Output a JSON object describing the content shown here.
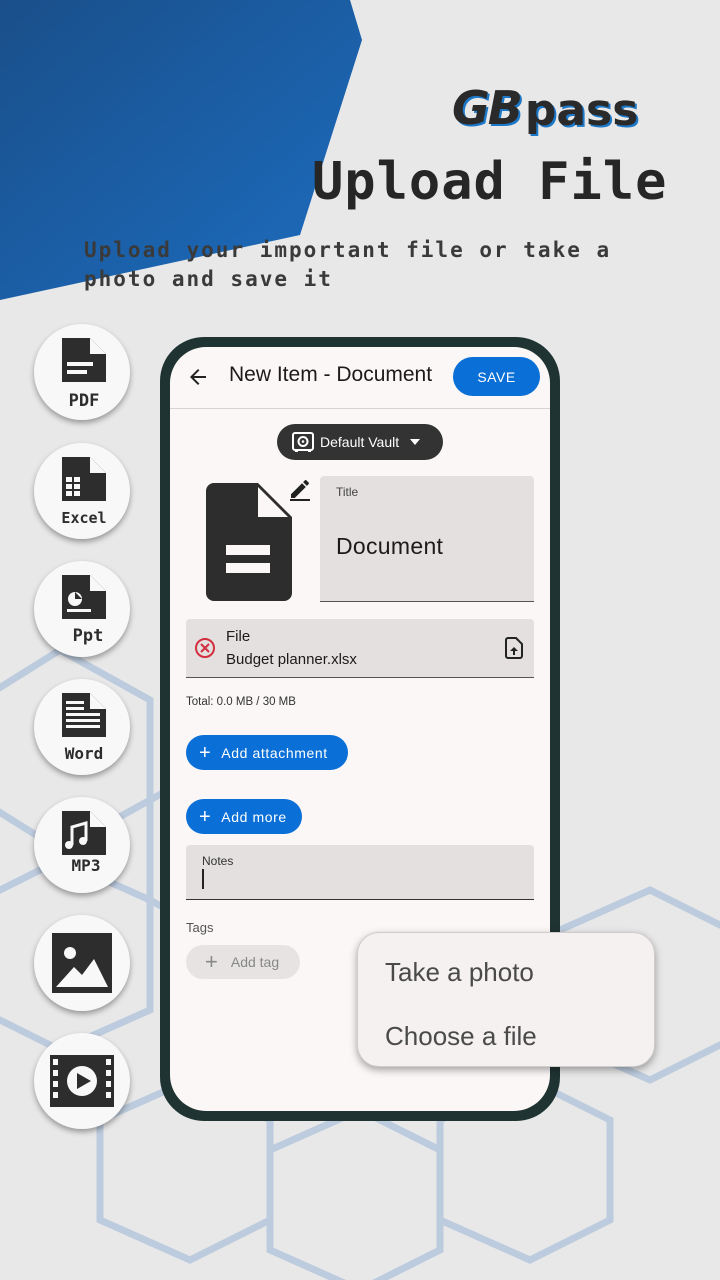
{
  "colors": {
    "accent": "#0a6fd6",
    "brand_blue": "#1d68b6",
    "phone_frame": "#1f3332"
  },
  "logo": {
    "gb": "GB",
    "pass": "pass"
  },
  "hero": {
    "title": "Upload File",
    "subtitle": "Upload your important file or take a photo and save it"
  },
  "file_types": [
    {
      "label": "PDF",
      "icon": "pdf-file-icon"
    },
    {
      "label": "Excel",
      "icon": "excel-file-icon"
    },
    {
      "label": "Ppt",
      "icon": "ppt-file-icon"
    },
    {
      "label": "Word",
      "icon": "word-file-icon"
    },
    {
      "label": "MP3",
      "icon": "mp3-file-icon"
    },
    {
      "label": "",
      "icon": "image-file-icon"
    },
    {
      "label": "",
      "icon": "video-file-icon"
    }
  ],
  "app": {
    "title": "New Item - Document",
    "save_label": "SAVE",
    "vault": "Default Vault",
    "title_field": {
      "label": "Title",
      "value": "Document"
    },
    "file": {
      "label": "File",
      "name": "Budget planner.xlsx"
    },
    "total": "Total: 0.0 MB / 30 MB",
    "add_attachment": "Add attachment",
    "add_more": "Add more",
    "notes_label": "Notes",
    "tags_label": "Tags",
    "add_tag": "Add tag"
  },
  "popup": {
    "take_photo": "Take a photo",
    "choose_file": "Choose a file"
  }
}
